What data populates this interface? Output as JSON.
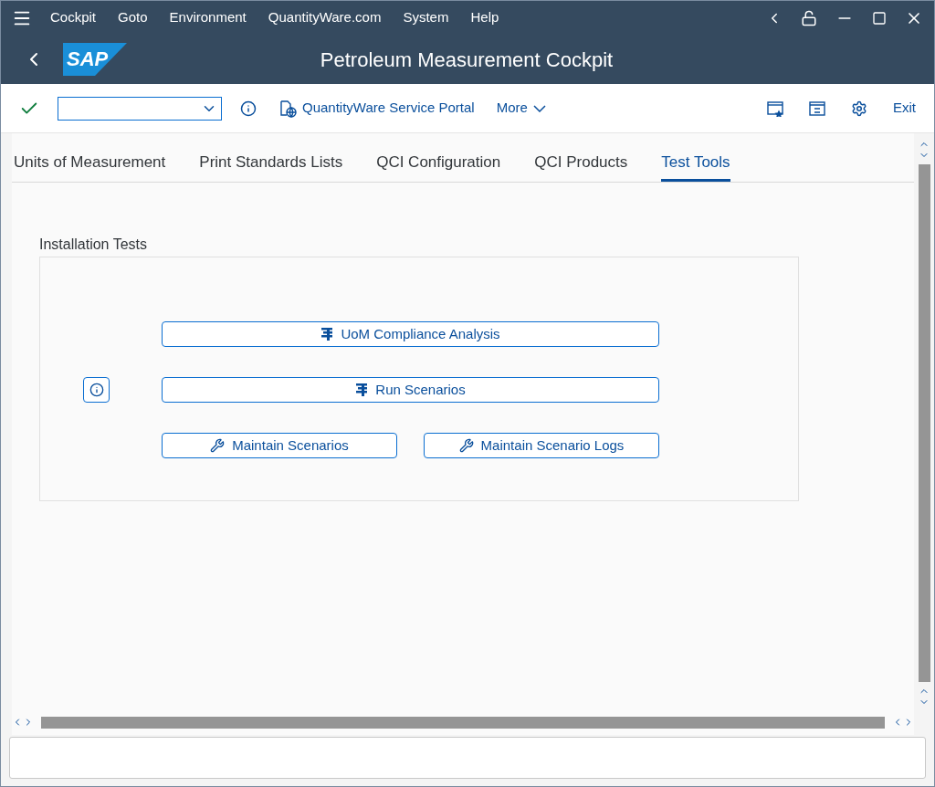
{
  "menu_bar": {
    "items": [
      "Cockpit",
      "Goto",
      "Environment",
      "QuantityWare.com",
      "System",
      "Help"
    ]
  },
  "header": {
    "logo": "SAP",
    "title": "Petroleum Measurement Cockpit"
  },
  "toolbar": {
    "buttons": [
      {
        "label": "QuantityWare Service Portal",
        "kind": "portal"
      },
      {
        "label": "More",
        "kind": "more"
      }
    ],
    "exit": "Exit"
  },
  "tabs": [
    {
      "label": "Units of Measurement",
      "selected": false
    },
    {
      "label": "Print Standards Lists",
      "selected": false
    },
    {
      "label": "QCI Configuration",
      "selected": false
    },
    {
      "label": "QCI Products",
      "selected": false
    },
    {
      "label": "Test Tools",
      "selected": true
    }
  ],
  "group": {
    "title": "Installation Tests",
    "rows": [
      {
        "info": false,
        "buttons": [
          {
            "label": "UoM Compliance Analysis",
            "kind": "run"
          }
        ]
      },
      {
        "info": true,
        "buttons": [
          {
            "label": "Run Scenarios",
            "kind": "run"
          }
        ]
      },
      {
        "info": false,
        "buttons": [
          {
            "label": "Maintain Scenarios",
            "kind": "maintain"
          },
          {
            "label": "Maintain Scenario Logs",
            "kind": "maintain"
          }
        ]
      }
    ]
  }
}
